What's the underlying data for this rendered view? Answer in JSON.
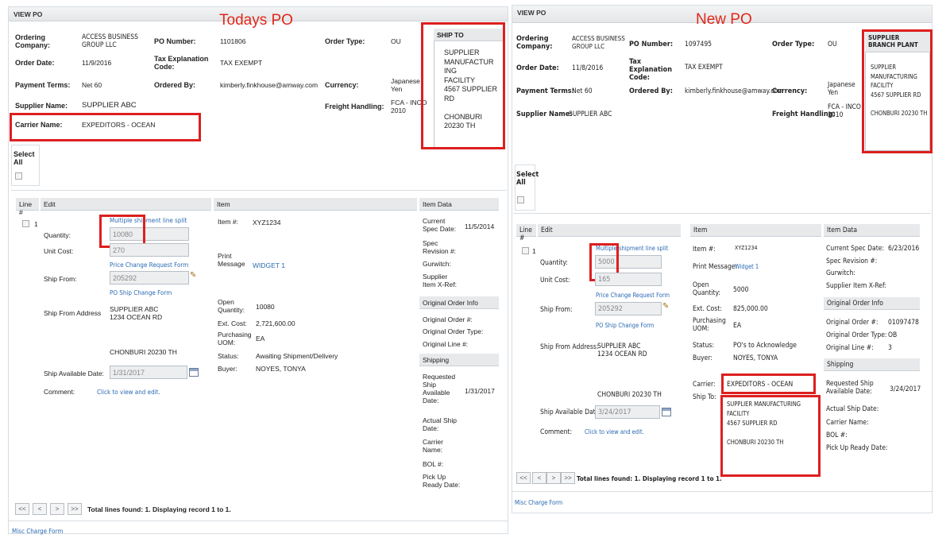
{
  "left": {
    "annotation_title": "Todays PO",
    "panel_title": "VIEW PO",
    "header": {
      "ordering_company_label": "Ordering Company:",
      "ordering_company": "ACCESS BUSINESS GROUP LLC",
      "po_number_label": "PO Number:",
      "po_number": "1101806",
      "order_type_label": "Order Type:",
      "order_type": "OU",
      "order_date_label": "Order Date:",
      "order_date": "11/9/2016",
      "tax_label": "Tax Explanation Code:",
      "tax": "TAX EXEMPT",
      "payment_terms_label": "Payment Terms:",
      "payment_terms": "Net 60",
      "ordered_by_label": "Ordered By:",
      "ordered_by": "kimberly.finkhouse@amway.com",
      "currency_label": "Currency:",
      "currency": "Japanese Yen",
      "supplier_name_label": "Supplier Name:",
      "supplier_name": "SUPPLIER ABC",
      "freight_label": "Freight Handling:",
      "freight": "FCA - INCO 2010",
      "carrier_label": "Carrier Name:",
      "carrier": "EXPEDITORS - OCEAN",
      "ship_to_title": "SHIP TO",
      "ship_to": "SUPPLIER\nMANUFACTUR\nING\nFACILITY\n4567 SUPPLIER\nRD\n\nCHONBURI\n20230 TH"
    },
    "select_all": "Select All",
    "columns": {
      "line": "Line #",
      "edit": "Edit",
      "item": "Item",
      "item_data": "Item Data"
    },
    "line": {
      "number": "1",
      "multi_link": "Multiple shipment line split",
      "quantity_label": "Quantity:",
      "quantity": "10080",
      "unit_cost_label": "Unit Cost:",
      "unit_cost": "270",
      "price_change_link": "Price Change Request Form",
      "ship_from_label": "Ship From:",
      "ship_from": "205292",
      "po_ship_change_link": "PO Ship Change Form",
      "ship_from_address_label": "Ship From Address",
      "ship_from_address": "SUPPLIER ABC\n1234 OCEAN RD",
      "ship_from_city": "CHONBURI 20230 TH",
      "ship_avail_label": "Ship Available Date:",
      "ship_avail": "1/31/2017",
      "comment_label": "Comment:",
      "comment_link": "Click to view and edit.",
      "item_no_label": "Item #:",
      "item_no": "XYZ1234",
      "print_msg_label": "Print Message",
      "print_msg": "WIDGET 1",
      "open_qty_label": "Open Quantity:",
      "open_qty": "10080",
      "ext_cost_label": "Ext. Cost:",
      "ext_cost": "2,721,600.00",
      "purch_uom_label": "Purchasing UOM:",
      "purch_uom": "EA",
      "status_label": "Status:",
      "status": "Awaiting Shipment/Delivery",
      "buyer_label": "Buyer:",
      "buyer": "NOYES, TONYA",
      "spec_date_label": "Current Spec Date:",
      "spec_date": "11/5/2014",
      "spec_rev_label": "Spec Revision #:",
      "gurwitch_label": "Gurwitch:",
      "xref_label": "Supplier Item X-Ref:",
      "orig_title": "Original Order Info",
      "orig_order_label": "Original Order #:",
      "orig_type_label": "Original Order Type:",
      "orig_line_label": "Original Line #:",
      "shipping_title": "Shipping",
      "req_ship_label": "Requested Ship Available Date:",
      "req_ship": "1/31/2017",
      "actual_ship_label": "Actual Ship Date:",
      "carrier_name_label": "Carrier Name:",
      "bol_label": "BOL #:",
      "pickup_label": "Pick Up Ready Date:"
    },
    "pager": {
      "first": "<<",
      "prev": "<",
      "next": ">",
      "last": ">>",
      "text": "Total lines found: 1. Displaying record 1 to 1."
    },
    "misc_link": "Misc Charge Form"
  },
  "right": {
    "annotation_title": "New PO",
    "panel_title": "VIEW PO",
    "header": {
      "ordering_company_label": "Ordering Company:",
      "ordering_company": "ACCESS BUSINESS GROUP LLC",
      "po_number_label": "PO Number:",
      "po_number": "1097495",
      "order_type_label": "Order Type:",
      "order_type": "OU",
      "order_date_label": "Order Date:",
      "order_date": "11/8/2016",
      "tax_label": "Tax Explanation Code:",
      "tax": "TAX EXEMPT",
      "payment_terms_label": "Payment Terms:",
      "payment_terms": "Net 60",
      "ordered_by_label": "Ordered By:",
      "ordered_by": "kimberly.finkhouse@amway.com",
      "currency_label": "Currency:",
      "currency": "Japanese Yen",
      "supplier_name_label": "Supplier Name:",
      "supplier_name": "SUPPLIER ABC",
      "freight_label": "Freight Handling:",
      "freight": "FCA - INCO 2010",
      "plant_title": "SUPPLIER BRANCH PLANT",
      "plant": "SUPPLIER\nMANUFACTURING\nFACILITY\n4567 SUPPLIER RD\n\nCHONBURI 20230 TH"
    },
    "select_all": "Select All",
    "columns": {
      "line": "Line #",
      "edit": "Edit",
      "item": "Item",
      "item_data": "Item Data"
    },
    "line": {
      "number": "1",
      "multi_link": "Multiple shipment line split",
      "quantity_label": "Quantity:",
      "quantity": "5000",
      "unit_cost_label": "Unit Cost:",
      "unit_cost": "165",
      "price_change_link": "Price Change Request Form",
      "ship_from_label": "Ship From:",
      "ship_from": "205292",
      "po_ship_change_link": "PO Ship Change Form",
      "ship_from_address_label": "Ship From Address:",
      "ship_from_address": "SUPPLIER ABC\n1234 OCEAN RD",
      "ship_from_city": "CHONBURI 20230 TH",
      "ship_avail_label": "Ship Available Date:",
      "ship_avail": "3/24/2017",
      "comment_label": "Comment:",
      "comment_link": "Click to view and edit.",
      "item_no_label": "Item #:",
      "item_no": "XYZ1234",
      "print_msg_label": "Print Message:",
      "print_msg": "Widget 1",
      "open_qty_label": "Open Quantity:",
      "open_qty": "5000",
      "ext_cost_label": "Ext. Cost:",
      "ext_cost": "825,000.00",
      "purch_uom_label": "Purchasing UOM:",
      "purch_uom": "EA",
      "status_label": "Status:",
      "status": "PO's to Acknowledge",
      "buyer_label": "Buyer:",
      "buyer": "NOYES, TONYA",
      "carrier_label": "Carrier:",
      "carrier": "EXPEDITORS - OCEAN",
      "ship_to_label": "Ship To:",
      "ship_to": "SUPPLIER MANUFACTURING FACILITY\n4567 SUPPLIER RD\n\nCHONBURI 20230 TH",
      "item_data_title": "Item Data",
      "spec_date_label": "Current Spec Date:",
      "spec_date": "6/23/2016",
      "spec_rev_label": "Spec Revision #:",
      "gurwitch_label": "Gurwitch:",
      "xref_label": "Supplier Item X-Ref:",
      "orig_title": "Original Order Info",
      "orig_order_label": "Original Order #:",
      "orig_order": "01097478",
      "orig_type_label": "Original Order Type:",
      "orig_type": "OB",
      "orig_line_label": "Original Line #:",
      "orig_line": "3",
      "shipping_title": "Shipping",
      "req_ship_label": "Requested Ship Available Date:",
      "req_ship": "3/24/2017",
      "actual_ship_label": "Actual Ship Date:",
      "carrier_name_label": "Carrier Name:",
      "bol_label": "BOL #:",
      "pickup_label": "Pick Up Ready Date:"
    },
    "pager": {
      "first": "<<",
      "prev": "<",
      "next": ">",
      "last": ">>",
      "text": "Total lines found: 1. Displaying record 1 to 1."
    },
    "misc_link": "Misc Charge Form"
  },
  "colors": {
    "annotation_red": "#dd1f1f",
    "link_blue": "#2a6ab3"
  }
}
